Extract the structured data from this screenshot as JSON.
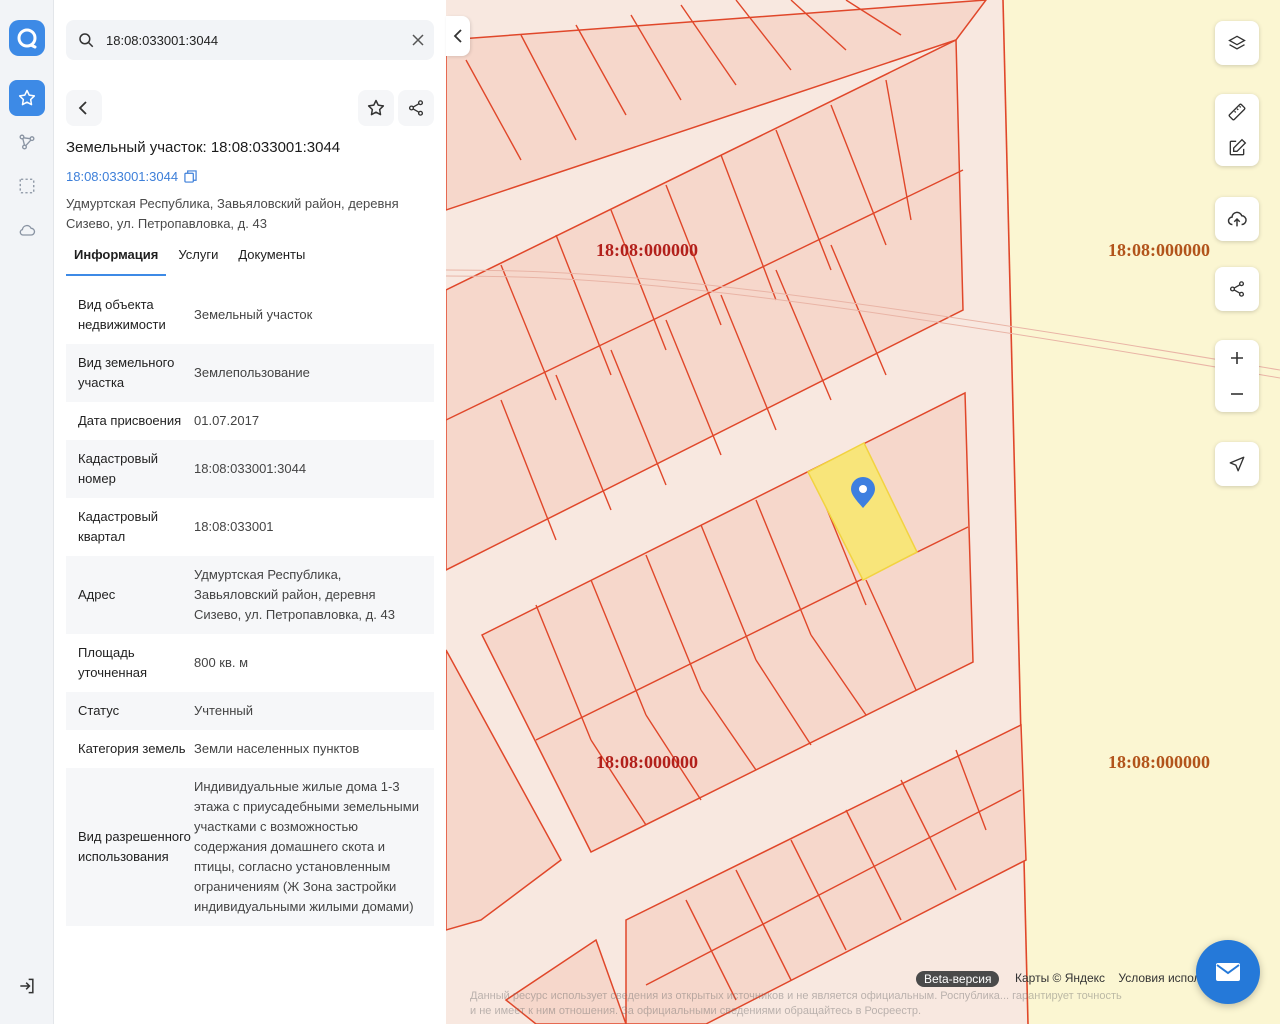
{
  "search": {
    "value": "18:08:033001:3044"
  },
  "card": {
    "title": "Земельный участок: 18:08:033001:3044",
    "cadastral_link": "18:08:033001:3044",
    "address": "Удмуртская Республика, Завьяловский район, деревня Сизево, ул. Петропавловка, д. 43"
  },
  "tabs": [
    "Информация",
    "Услуги",
    "Документы"
  ],
  "rows": [
    {
      "key": "Вид объекта недвижимости",
      "value": "Земельный участок"
    },
    {
      "key": "Вид земельного участка",
      "value": "Землепользование"
    },
    {
      "key": "Дата присвоения",
      "value": "01.07.2017"
    },
    {
      "key": "Кадастровый номер",
      "value": "18:08:033001:3044"
    },
    {
      "key": "Кадастровый квартал",
      "value": "18:08:033001"
    },
    {
      "key": "Адрес",
      "value": "Удмуртская Республика, Завьяловский район, деревня Сизево, ул. Петропавловка, д. 43"
    },
    {
      "key": "Площадь уточненная",
      "value": "800 кв. м"
    },
    {
      "key": "Статус",
      "value": "Учтенный"
    },
    {
      "key": "Категория земель",
      "value": "Земли населенных пунктов"
    },
    {
      "key": "Вид разрешенного использования",
      "value": "Индивидуальные жилые дома 1-3 этажа с приусадебными земельными участками с возможностью содержания домашнего скота и птицы, согласно установленным ограничениям (Ж Зона застройки индивидуальными жилыми домами)"
    }
  ],
  "map": {
    "labels": [
      "18:08:000000",
      "18:08:000000",
      "18:08:000000",
      "18:08:000000"
    ],
    "beta_label": "Beta-версия",
    "credits": [
      "Карты © Яндекс",
      "Условия испол"
    ],
    "disclaimer": "Данный ресурс использует сведения из открытых источников и не является официальным. Роспублика... гарантирует точность и не имеет к ним отношения. За официальными сведениями обращайтесь в Росреестр."
  },
  "colors": {
    "accent": "#3d8ae6",
    "parcel_fill": "#f6d7cb",
    "parcel_line": "#e0472a",
    "selected_fill": "#f8e57a",
    "zone_fill": "#fbf6d2"
  }
}
